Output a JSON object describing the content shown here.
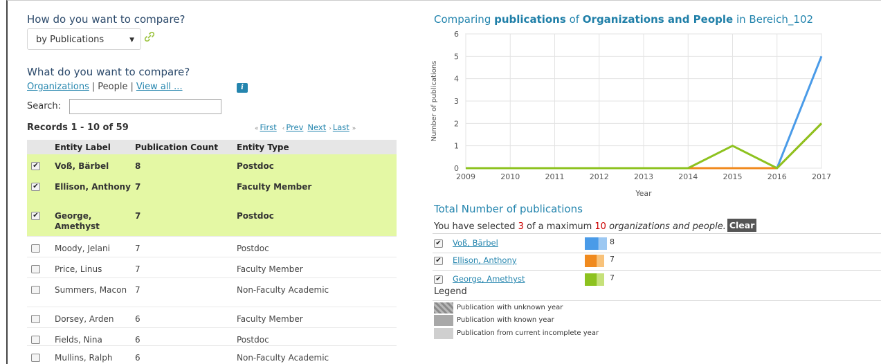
{
  "compare_how": {
    "heading": "How do you want to compare?",
    "selected": "by Publications",
    "link_icon": "chain-link-icon"
  },
  "compare_what": {
    "heading": "What do you want to compare?",
    "link_organizations": "Organizations",
    "sep1": "|",
    "people_label": "People",
    "sep2": "|",
    "link_view_all": "View all ...",
    "info_icon": "i"
  },
  "search": {
    "label": "Search:",
    "value": ""
  },
  "records": {
    "summary": "Records 1 - 10 of 59"
  },
  "pager": {
    "first": "First",
    "prev": "Prev",
    "next": "Next",
    "last": "Last",
    "prev_arrow": "«",
    "prev_single_arrow": "‹",
    "next_single_arrow": "›",
    "next_arrow": "»"
  },
  "table": {
    "headers": [
      "Entity Label",
      "Publication Count",
      "Entity Type"
    ],
    "rows": [
      {
        "label": "Voß, Bärbel",
        "count": "8",
        "type": "Postdoc",
        "checked": true
      },
      {
        "label": "Ellison, Anthony",
        "count": "7",
        "type": "Faculty Member",
        "checked": true
      },
      {
        "label": "George, Amethyst",
        "count": "7",
        "type": "Postdoc",
        "checked": true
      },
      {
        "label": "Moody, Jelani",
        "count": "7",
        "type": "Postdoc",
        "checked": false
      },
      {
        "label": "Price, Linus",
        "count": "7",
        "type": "Faculty Member",
        "checked": false
      },
      {
        "label": "Summers, Macon",
        "count": "7",
        "type": "Non-Faculty Academic",
        "checked": false
      },
      {
        "label": "Dorsey, Arden",
        "count": "6",
        "type": "Faculty Member",
        "checked": false
      },
      {
        "label": "Fields, Nina",
        "count": "6",
        "type": "Postdoc",
        "checked": false
      },
      {
        "label": "Mullins, Ralph",
        "count": "6",
        "type": "Non-Faculty Academic",
        "checked": false
      }
    ]
  },
  "chart_header": {
    "prefix": "Comparing ",
    "metric": "publications",
    "mid": " of ",
    "entities": "Organizations and People",
    "suffix": " in Bereich_102"
  },
  "chart_data": {
    "type": "line",
    "xlabel": "Year",
    "ylabel": "Number of publications",
    "x": [
      2009,
      2010,
      2011,
      2012,
      2013,
      2014,
      2015,
      2016,
      2017
    ],
    "ylim": [
      0,
      6
    ],
    "yticks": [
      0,
      1,
      2,
      3,
      4,
      5,
      6
    ],
    "grid": true,
    "series": [
      {
        "name": "Voß, Bärbel",
        "color": "#4a9be8",
        "values": [
          0,
          0,
          0,
          0,
          0,
          0,
          0,
          0,
          5
        ]
      },
      {
        "name": "Ellison, Anthony",
        "color": "#f08a1e",
        "values": [
          0,
          0,
          0,
          0,
          0,
          0,
          0,
          0,
          2
        ]
      },
      {
        "name": "George, Amethyst",
        "color": "#8dc21f",
        "values": [
          0,
          0,
          0,
          0,
          0,
          0,
          1,
          0,
          2
        ]
      }
    ]
  },
  "totals": {
    "heading": "Total Number of publications",
    "text_before": "You have selected ",
    "selected_count": "3",
    "text_mid": " of a maximum ",
    "max_count": "10",
    "text_entities": "organizations and people.",
    "clear_label": "Clear",
    "items": [
      {
        "label": "Voß, Bärbel",
        "value": "8",
        "checked": true,
        "color_dark": "#4a9be8",
        "color_light": "#9cc8f2"
      },
      {
        "label": "Ellison, Anthony",
        "value": "7",
        "checked": true,
        "color_dark": "#f08a1e",
        "color_light": "#f8c27a"
      },
      {
        "label": "George, Amethyst",
        "value": "7",
        "checked": true,
        "color_dark": "#8dc21f",
        "color_light": "#c6e17a"
      }
    ]
  },
  "legend": {
    "heading": "Legend",
    "items": [
      "Publication with unknown year",
      "Publication with known year",
      "Publication from current incomplete year"
    ]
  },
  "colors": {
    "accent": "#2485ae",
    "selected_row_bg": "#e4f8a4",
    "header_bg": "#e6e6e6",
    "highlight_red": "#cc0000"
  }
}
